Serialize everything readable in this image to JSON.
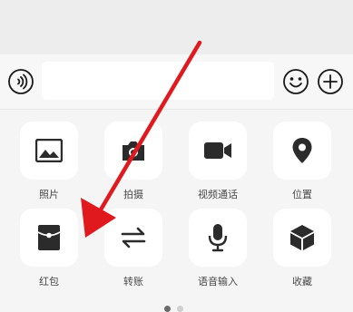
{
  "input_bar": {
    "voice_icon": "voice-wave-icon",
    "text_value": "",
    "emoji_icon": "smiley-face-icon",
    "plus_icon": "plus-circle-icon"
  },
  "panel": {
    "items": [
      {
        "label": "照片",
        "icon": "image-icon"
      },
      {
        "label": "拍摄",
        "icon": "camera-icon"
      },
      {
        "label": "视频通话",
        "icon": "video-camera-icon"
      },
      {
        "label": "位置",
        "icon": "location-pin-icon"
      },
      {
        "label": "红包",
        "icon": "red-envelope-icon"
      },
      {
        "label": "转账",
        "icon": "transfer-arrows-icon"
      },
      {
        "label": "语音输入",
        "icon": "microphone-icon"
      },
      {
        "label": "收藏",
        "icon": "cube-icon"
      }
    ],
    "page_count": 2,
    "active_page": 1
  },
  "colors": {
    "annotation_arrow": "#e0191f",
    "icon": "#2b2b2b",
    "tile_bg": "#ffffff",
    "panel_bg": "#f5f5f5"
  }
}
